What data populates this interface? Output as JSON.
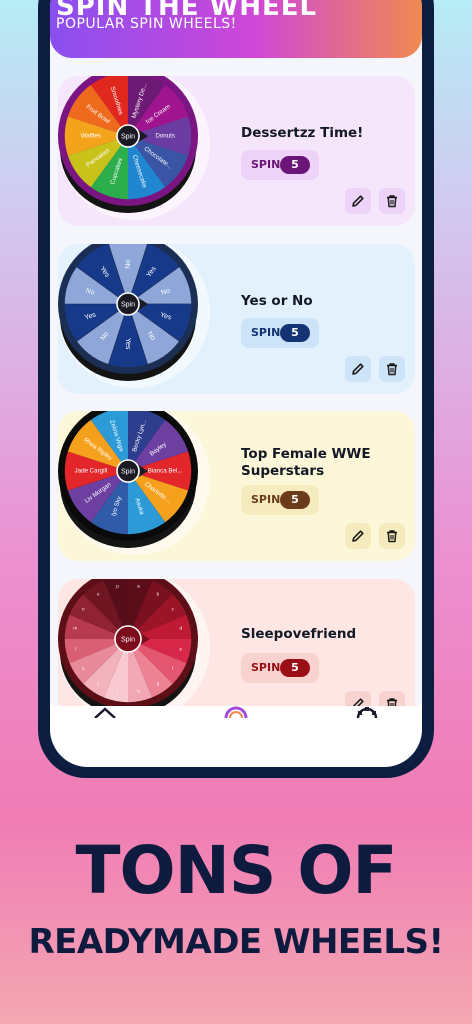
{
  "header": {
    "title": "SPIN THE WHEEL",
    "subtitle": "POPULAR SPIN WHEELS!"
  },
  "center_label": "Spin",
  "spin_label": "SPIN",
  "cards": [
    {
      "name": "Dessertzz Time!",
      "count": "5",
      "bg": "#f5e6fb",
      "pill_bg": "#ecd3f7",
      "accent": "#6a1577",
      "rim": "#7a1582",
      "segments": [
        {
          "label": "Mystery De...",
          "color": "#6d1a74"
        },
        {
          "label": "Ice Cream",
          "color": "#a0158f"
        },
        {
          "label": "Donuts",
          "color": "#6a3ba0"
        },
        {
          "label": "Chocolate...",
          "color": "#3a55a5"
        },
        {
          "label": "Cheesecake",
          "color": "#1f86cf"
        },
        {
          "label": "Cupcakes",
          "color": "#2dae4c"
        },
        {
          "label": "Pancakes",
          "color": "#c8c21a"
        },
        {
          "label": "Waffles",
          "color": "#f4a41a"
        },
        {
          "label": "Fruit Bowl",
          "color": "#ee6a1c"
        },
        {
          "label": "Smoothies",
          "color": "#e1281f"
        }
      ]
    },
    {
      "name": "Yes or  No",
      "count": "5",
      "bg": "#e3f1fd",
      "pill_bg": "#cde3f7",
      "accent": "#143373",
      "rim": "#1b2f55",
      "segments": [
        {
          "label": "No",
          "color": "#8ea6d8"
        },
        {
          "label": "Yes",
          "color": "#17398a"
        },
        {
          "label": "No",
          "color": "#8ea6d8"
        },
        {
          "label": "Yes",
          "color": "#17398a"
        },
        {
          "label": "No",
          "color": "#8ea6d8"
        },
        {
          "label": "Yes",
          "color": "#17398a"
        },
        {
          "label": "No",
          "color": "#8ea6d8"
        },
        {
          "label": "Yes",
          "color": "#17398a"
        },
        {
          "label": "No",
          "color": "#8ea6d8"
        },
        {
          "label": "Yes",
          "color": "#17398a"
        }
      ]
    },
    {
      "name": "Top Female WWE Superstars",
      "count": "5",
      "bg": "#fdf7d9",
      "pill_bg": "#f6ebbf",
      "accent": "#6b3c1a",
      "rim": "#0a0a0a",
      "segments": [
        {
          "label": "Becky Lyn...",
          "color": "#2d3e8f"
        },
        {
          "label": "Bayley",
          "color": "#6c3fa0"
        },
        {
          "label": "Bianca Bel...",
          "color": "#e3262a"
        },
        {
          "label": "Charlotte ...",
          "color": "#f6a11d"
        },
        {
          "label": "Asuka",
          "color": "#2b9ad6"
        },
        {
          "label": "Iyo Sky",
          "color": "#2f5ba8"
        },
        {
          "label": "Liv Morgan",
          "color": "#6c3fa0"
        },
        {
          "label": "Jade Cargill",
          "color": "#e3262a"
        },
        {
          "label": "Rhea Ripley",
          "color": "#f6a11d"
        },
        {
          "label": "Zelina Vega",
          "color": "#2b9ad6"
        }
      ]
    },
    {
      "name": "Sleepovefriend",
      "count": "5",
      "bg": "#fde6e3",
      "pill_bg": "#f8d2ce",
      "accent": "#9a0f16",
      "rim": "#5d0f17",
      "segments": [
        {
          "label": "a",
          "color": "#5c0d1a"
        },
        {
          "label": "b",
          "color": "#7a1020"
        },
        {
          "label": "c",
          "color": "#9b1428"
        },
        {
          "label": "d",
          "color": "#be1a33"
        },
        {
          "label": "e",
          "color": "#d8284a"
        },
        {
          "label": "f",
          "color": "#e4566f"
        },
        {
          "label": "g",
          "color": "#ec8294"
        },
        {
          "label": "h",
          "color": "#f2a8b4"
        },
        {
          "label": "i",
          "color": "#f8c9d0"
        },
        {
          "label": "j",
          "color": "#f3b3bc"
        },
        {
          "label": "k",
          "color": "#e88a99"
        },
        {
          "label": "l",
          "color": "#d96074"
        },
        {
          "label": "m",
          "color": "#b73a50"
        },
        {
          "label": "n",
          "color": "#8f2233"
        },
        {
          "label": "o",
          "color": "#701623"
        },
        {
          "label": "p",
          "color": "#560f1a"
        }
      ]
    }
  ],
  "promo": {
    "line1": "TONS OF",
    "line2": "READYMADE WHEELS!"
  },
  "nav": [
    "home-icon",
    "wheel-icon",
    "settings-icon"
  ]
}
